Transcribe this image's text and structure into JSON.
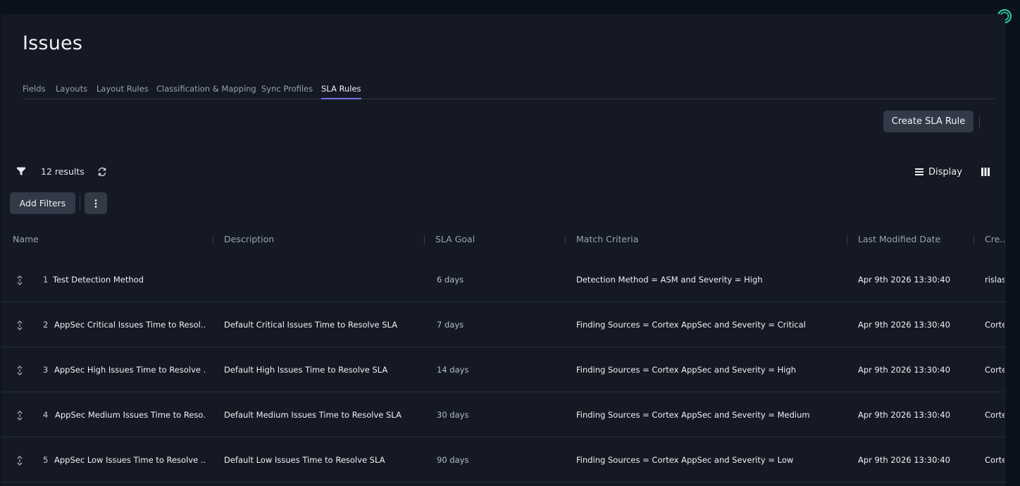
{
  "page": {
    "title": "Issues"
  },
  "tabs": [
    {
      "label": "Fields"
    },
    {
      "label": "Layouts"
    },
    {
      "label": "Layout Rules"
    },
    {
      "label": "Classification & Mapping"
    },
    {
      "label": "Sync Profiles"
    },
    {
      "label": "SLA Rules",
      "active": true
    }
  ],
  "toolbar": {
    "create_label": "Create SLA Rule",
    "results": "12 results",
    "display_label": "Display",
    "add_filters_label": "Add Filters"
  },
  "table": {
    "columns": [
      "Name",
      "Description",
      "SLA Goal",
      "Match Criteria",
      "Last Modified Date",
      "Cre..."
    ],
    "rows": [
      {
        "index": "1",
        "name": "Test Detection Method",
        "description": "",
        "sla_goal": "6 days",
        "criteria": "Detection Method = ASM and Severity = High",
        "modified": "Apr 9th 2026 13:30:40",
        "created_by": "rislas"
      },
      {
        "index": "2",
        "name": "AppSec Critical Issues Time to Resol...",
        "description": "Default Critical Issues Time to Resolve SLA",
        "sla_goal": "7 days",
        "criteria": "Finding Sources = Cortex AppSec and Severity = Critical",
        "modified": "Apr 9th 2026 13:30:40",
        "created_by": "Corte"
      },
      {
        "index": "3",
        "name": "AppSec High Issues Time to Resolve ...",
        "description": "Default High Issues Time to Resolve SLA",
        "sla_goal": "14 days",
        "criteria": "Finding Sources = Cortex AppSec and Severity = High",
        "modified": "Apr 9th 2026 13:30:40",
        "created_by": "Corte"
      },
      {
        "index": "4",
        "name": "AppSec Medium Issues Time to Reso...",
        "description": "Default Medium Issues Time to Resolve SLA",
        "sla_goal": "30 days",
        "criteria": "Finding Sources = Cortex AppSec and Severity = Medium",
        "modified": "Apr 9th 2026 13:30:40",
        "created_by": "Corte"
      },
      {
        "index": "5",
        "name": "AppSec Low Issues Time to Resolve ...",
        "description": "Default Low Issues Time to Resolve SLA",
        "sla_goal": "90 days",
        "criteria": "Finding Sources = Cortex AppSec and Severity = Low",
        "modified": "Apr 9th 2026 13:30:40",
        "created_by": "Corte"
      }
    ]
  },
  "colors": {
    "accent": "#7b70e6",
    "panel": "#141923",
    "button": "#323a48",
    "logo": "#2fd0b0"
  },
  "icons": [
    "filter-icon",
    "refresh-icon",
    "list-icon",
    "columns-icon",
    "more-vertical-icon",
    "drag-handle-icon",
    "app-logo-icon"
  ]
}
